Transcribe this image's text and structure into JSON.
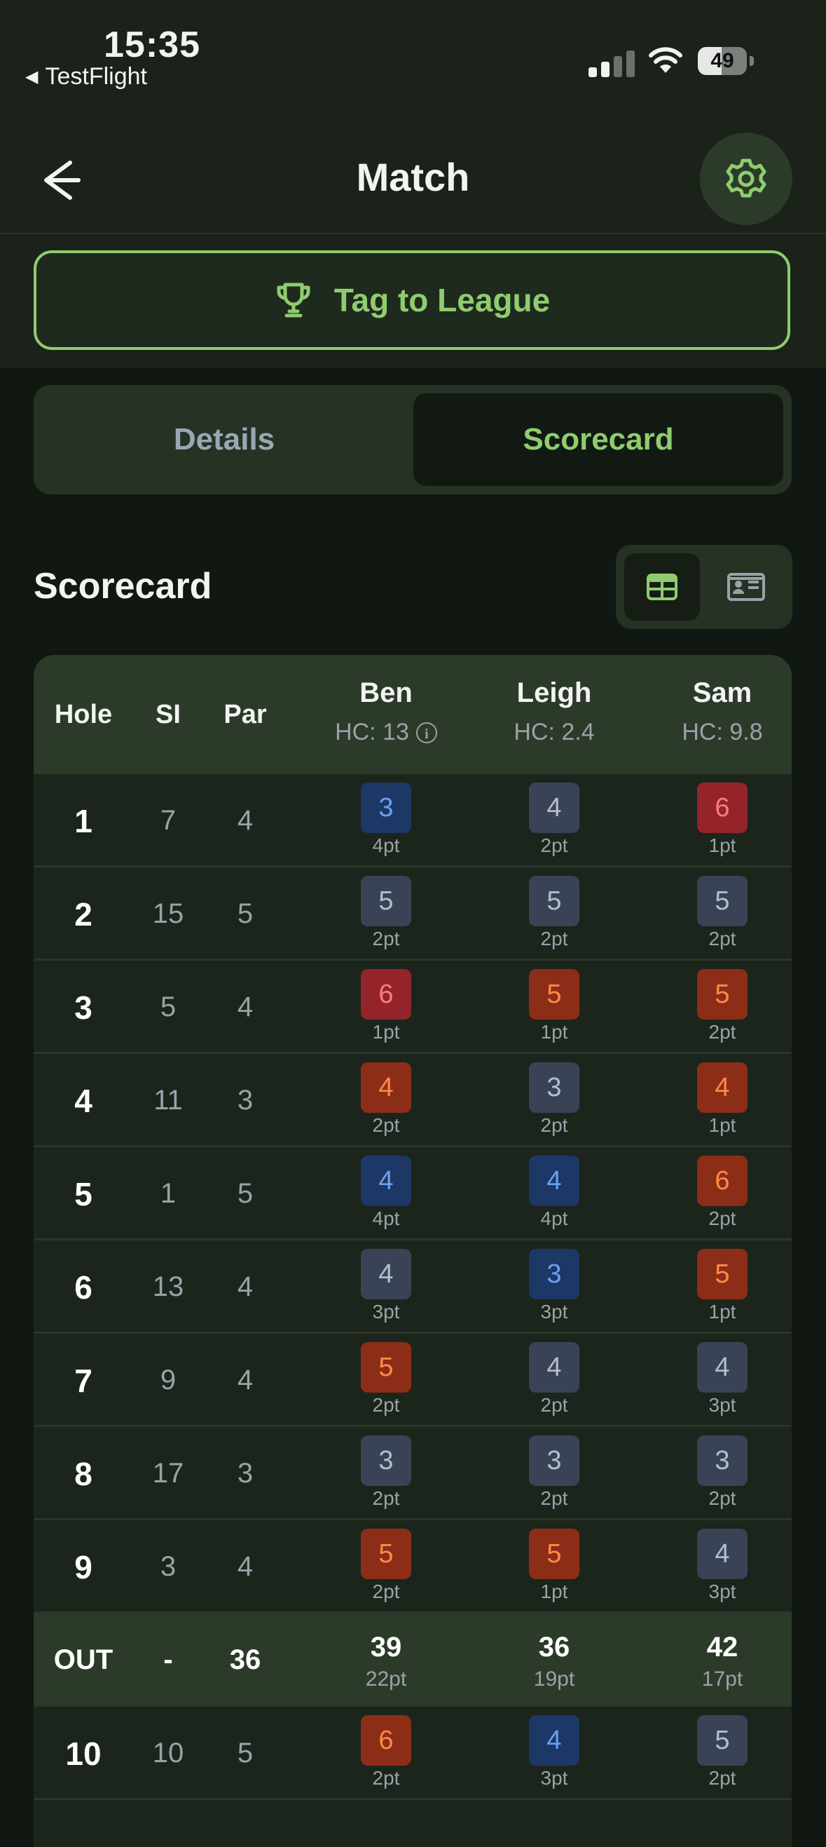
{
  "status": {
    "time": "15:35",
    "back_app": "TestFlight",
    "battery": "49"
  },
  "nav": {
    "title": "Match"
  },
  "tag_button": {
    "label": "Tag to League"
  },
  "tabs": [
    {
      "label": "Details"
    },
    {
      "label": "Scorecard"
    }
  ],
  "section": {
    "title": "Scorecard"
  },
  "table": {
    "headers": {
      "hole": "Hole",
      "si": "SI",
      "par": "Par"
    },
    "players": [
      {
        "name": "Ben",
        "hc": "HC: 13"
      },
      {
        "name": "Leigh",
        "hc": "HC: 2.4"
      },
      {
        "name": "Sam",
        "hc": "HC: 9.8"
      }
    ],
    "rows": [
      {
        "hole": "1",
        "si": "7",
        "par": "4",
        "scores": [
          {
            "v": "3",
            "p": "4pt",
            "t": "birdie"
          },
          {
            "v": "4",
            "p": "2pt",
            "t": "par"
          },
          {
            "v": "6",
            "p": "1pt",
            "t": "double"
          }
        ]
      },
      {
        "hole": "2",
        "si": "15",
        "par": "5",
        "scores": [
          {
            "v": "5",
            "p": "2pt",
            "t": "par"
          },
          {
            "v": "5",
            "p": "2pt",
            "t": "par"
          },
          {
            "v": "5",
            "p": "2pt",
            "t": "par"
          }
        ]
      },
      {
        "hole": "3",
        "si": "5",
        "par": "4",
        "scores": [
          {
            "v": "6",
            "p": "1pt",
            "t": "double"
          },
          {
            "v": "5",
            "p": "1pt",
            "t": "bogey"
          },
          {
            "v": "5",
            "p": "2pt",
            "t": "bogey"
          }
        ]
      },
      {
        "hole": "4",
        "si": "11",
        "par": "3",
        "scores": [
          {
            "v": "4",
            "p": "2pt",
            "t": "bogey"
          },
          {
            "v": "3",
            "p": "2pt",
            "t": "par"
          },
          {
            "v": "4",
            "p": "1pt",
            "t": "bogey"
          }
        ]
      },
      {
        "hole": "5",
        "si": "1",
        "par": "5",
        "scores": [
          {
            "v": "4",
            "p": "4pt",
            "t": "birdie"
          },
          {
            "v": "4",
            "p": "4pt",
            "t": "birdie"
          },
          {
            "v": "6",
            "p": "2pt",
            "t": "bogey"
          }
        ]
      },
      {
        "hole": "6",
        "si": "13",
        "par": "4",
        "scores": [
          {
            "v": "4",
            "p": "3pt",
            "t": "par"
          },
          {
            "v": "3",
            "p": "3pt",
            "t": "birdie"
          },
          {
            "v": "5",
            "p": "1pt",
            "t": "bogey"
          }
        ]
      },
      {
        "hole": "7",
        "si": "9",
        "par": "4",
        "scores": [
          {
            "v": "5",
            "p": "2pt",
            "t": "bogey"
          },
          {
            "v": "4",
            "p": "2pt",
            "t": "par"
          },
          {
            "v": "4",
            "p": "3pt",
            "t": "par"
          }
        ]
      },
      {
        "hole": "8",
        "si": "17",
        "par": "3",
        "scores": [
          {
            "v": "3",
            "p": "2pt",
            "t": "par"
          },
          {
            "v": "3",
            "p": "2pt",
            "t": "par"
          },
          {
            "v": "3",
            "p": "2pt",
            "t": "par"
          }
        ]
      },
      {
        "hole": "9",
        "si": "3",
        "par": "4",
        "scores": [
          {
            "v": "5",
            "p": "2pt",
            "t": "bogey"
          },
          {
            "v": "5",
            "p": "1pt",
            "t": "bogey"
          },
          {
            "v": "4",
            "p": "3pt",
            "t": "par"
          }
        ]
      }
    ],
    "out": {
      "label": "OUT",
      "si": "-",
      "par": "36",
      "totals": [
        {
          "v": "39",
          "p": "22pt"
        },
        {
          "v": "36",
          "p": "19pt"
        },
        {
          "v": "42",
          "p": "17pt"
        }
      ]
    },
    "row10": {
      "hole": "10",
      "si": "10",
      "par": "5",
      "scores": [
        {
          "v": "6",
          "p": "2pt",
          "t": "bogey"
        },
        {
          "v": "4",
          "p": "3pt",
          "t": "birdie"
        },
        {
          "v": "5",
          "p": "2pt",
          "t": "par"
        }
      ]
    }
  },
  "colors": {
    "accent": "#8fcc6e",
    "birdie": "#1d3766",
    "bogey": "#8c2d18",
    "double": "#95232a",
    "par": "#3a4356"
  }
}
